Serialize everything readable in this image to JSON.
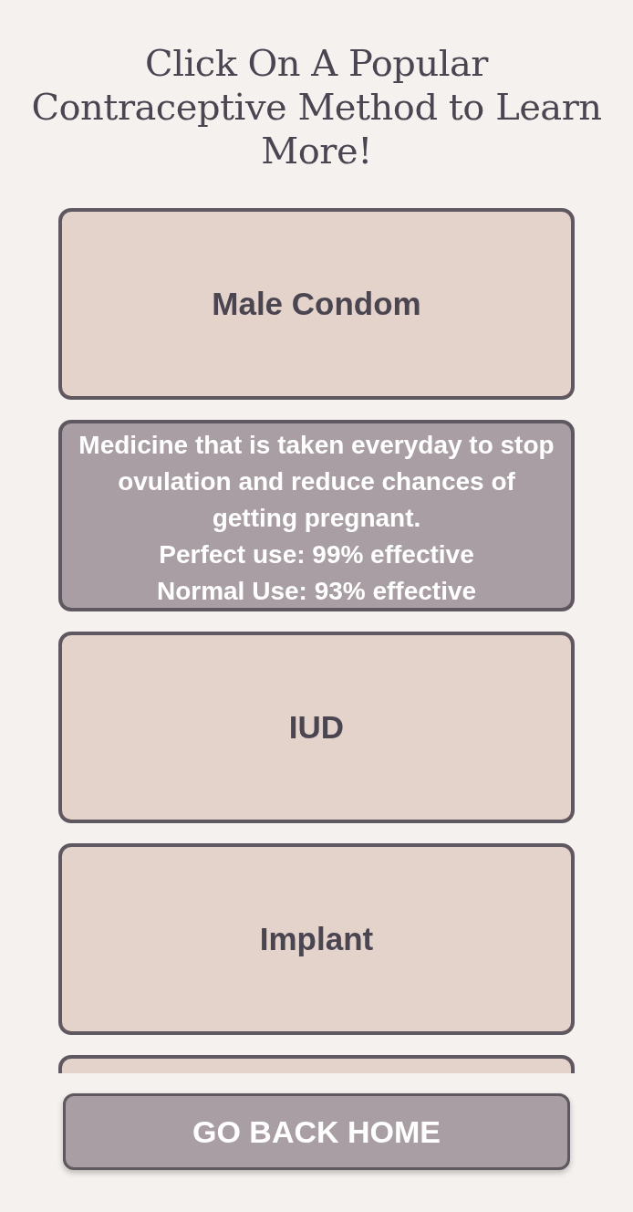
{
  "title": "Click On A Popular Contraceptive Method to Learn More!",
  "methods": [
    {
      "label": "Male Condom",
      "expanded": false
    },
    {
      "expanded": true,
      "details": [
        "Medicine that is taken everyday to stop ovulation and reduce chances of getting pregnant.",
        "Perfect use: 99% effective",
        "Normal Use: 93% effective"
      ]
    },
    {
      "label": "IUD",
      "expanded": false
    },
    {
      "label": "Implant",
      "expanded": false
    },
    {
      "expanded": false
    }
  ],
  "home_button": "GO BACK HOME"
}
